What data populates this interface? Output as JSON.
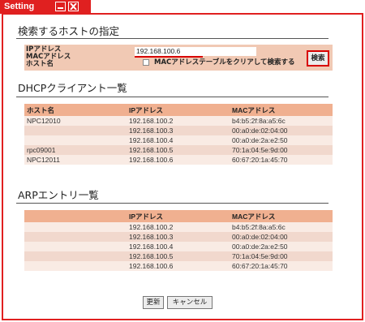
{
  "window": {
    "title": "Setting"
  },
  "search": {
    "heading": "検索するホストの指定",
    "labels": [
      "IPアドレス",
      "MACアドレス",
      "ホスト名"
    ],
    "ip_value": "192.168.100.6",
    "clear_mac_label": "MACアドレステーブルをクリアして検索する",
    "clear_mac_checked": false,
    "search_button": "検索"
  },
  "dhcp": {
    "heading": "DHCPクライアント一覧",
    "columns": [
      "ホスト名",
      "IPアドレス",
      "MACアドレス"
    ],
    "rows": [
      [
        "NPC12010",
        "192.168.100.2",
        "b4:b5:2f:8a:a5:6c"
      ],
      [
        "",
        "192.168.100.3",
        "00:a0:de:02:04:00"
      ],
      [
        "",
        "192.168.100.4",
        "00:a0:de:2a:e2:50"
      ],
      [
        "rpc09001",
        "192.168.100.5",
        "70:1a:04:5e:9d:00"
      ],
      [
        "NPC12011",
        "192.168.100.6",
        "60:67:20:1a:45:70"
      ]
    ]
  },
  "arp": {
    "heading": "ARPエントリ一覧",
    "columns": [
      "",
      "IPアドレス",
      "MACアドレス"
    ],
    "rows": [
      [
        "",
        "192.168.100.2",
        "b4:b5:2f:8a:a5:6c"
      ],
      [
        "",
        "192.168.100.3",
        "00:a0:de:02:04:00"
      ],
      [
        "",
        "192.168.100.4",
        "00:a0:de:2a:e2:50"
      ],
      [
        "",
        "192.168.100.5",
        "70:1a:04:5e:9d:00"
      ],
      [
        "",
        "192.168.100.6",
        "60:67:20:1a:45:70"
      ]
    ]
  },
  "buttons": {
    "refresh": "更新",
    "cancel": "キャンセル"
  },
  "colors": {
    "accent": "#e02020",
    "header": "#f0b090",
    "form_bg": "#f1c9b4"
  }
}
